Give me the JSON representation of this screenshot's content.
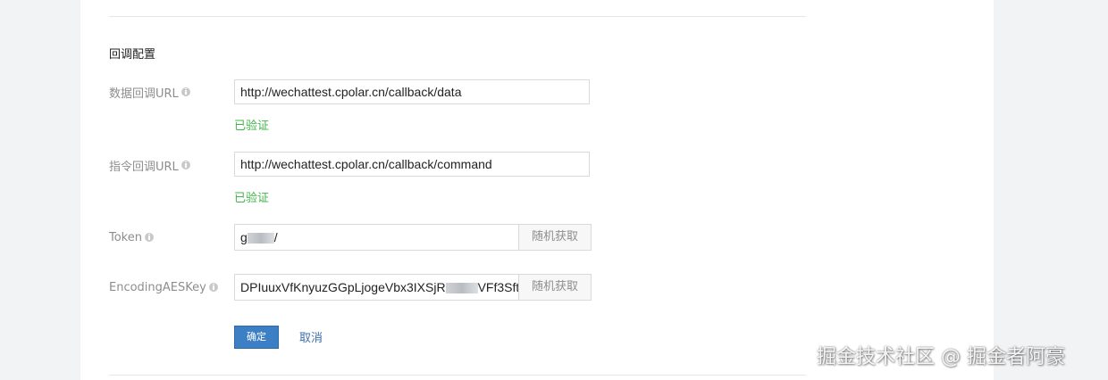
{
  "section": {
    "title": "回调配置"
  },
  "fields": {
    "data_url": {
      "label": "数据回调URL",
      "value": "http://wechattest.cpolar.cn/callback/data",
      "status": "已验证"
    },
    "command_url": {
      "label": "指令回调URL",
      "value": "http://wechattest.cpolar.cn/callback/command",
      "status": "已验证"
    },
    "token": {
      "label": "Token",
      "value_start": "g",
      "value_end": "/",
      "button": "随机获取"
    },
    "aes_key": {
      "label": "EncodingAESKey",
      "value_start": "DPIuuxVfKnyuzGGpLjogeVbx3IXSjR",
      "value_end": "VFf3Sft",
      "button": "随机获取"
    }
  },
  "actions": {
    "confirm": "确定",
    "cancel": "取消"
  },
  "watermark": "掘金技术社区 @ 掘金者阿豪",
  "colors": {
    "verified": "#44b549",
    "primary_button": "#3d7fc4",
    "link": "#3d6fa8"
  },
  "icons": {
    "field_help": "info-icon"
  }
}
